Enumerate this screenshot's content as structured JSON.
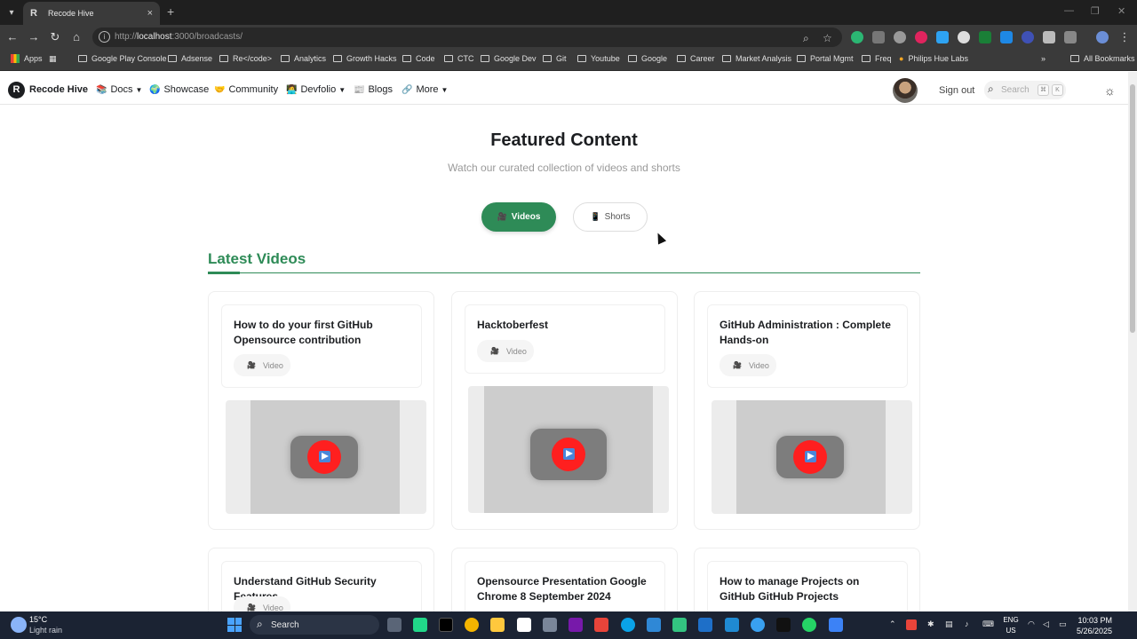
{
  "browser": {
    "tab_title": "Recode Hive",
    "tab_favicon": "R",
    "url_prefix": "http://",
    "url_host": "localhost",
    "url_rest": ":3000/broadcasts/",
    "bookmarks": [
      "Apps",
      "Google Play Console",
      "Adsense",
      "Re</code>",
      "Analytics",
      "Growth Hacks",
      "Code",
      "CTC",
      "Google Dev",
      "Git",
      "Youtube",
      "Google",
      "Career",
      "Market Analysis",
      "Portal Mgmt",
      "Freq",
      "Philips Hue Labs"
    ],
    "all_bookmarks": "All Bookmarks"
  },
  "site": {
    "brand": "Recode Hive",
    "nav": [
      {
        "label": "Docs",
        "icon": "📚"
      },
      {
        "label": "Showcase",
        "icon": "🌍"
      },
      {
        "label": "Community",
        "icon": "🤝"
      },
      {
        "label": "Devfolio",
        "icon": "👩‍💻"
      },
      {
        "label": "Blogs",
        "icon": "📰"
      },
      {
        "label": "More",
        "icon": "🔗"
      }
    ],
    "sign_out": "Sign out",
    "search_placeholder": "Search",
    "search_keys": [
      "⌘",
      "K"
    ]
  },
  "main": {
    "title": "Featured Content",
    "subtitle": "Watch our curated collection of videos and shorts",
    "tabs": [
      {
        "label": "Videos",
        "icon": "🎥",
        "active": true
      },
      {
        "label": "Shorts",
        "icon": "📱",
        "active": false
      }
    ],
    "section_heading": "Latest Videos",
    "badge_label": "Video",
    "badge_icon": "🎥",
    "videos": [
      {
        "title": "How to do your first GitHub Opensource contribution"
      },
      {
        "title": "Hacktoberfest"
      },
      {
        "title": "GitHub Administration : Complete Hands-on"
      },
      {
        "title": "Understand GitHub Security Features"
      },
      {
        "title": "Opensource Presentation Google Chrome 8 September 2024"
      },
      {
        "title": "How to manage Projects on GitHub GitHub Projects"
      }
    ],
    "accent_color": "#2e8b57"
  },
  "taskbar": {
    "temperature": "15°C",
    "weather": "Light rain",
    "search": "Search",
    "lang_top": "ENG",
    "lang_bottom": "US",
    "time": "10:03 PM",
    "date": "5/26/2025"
  }
}
